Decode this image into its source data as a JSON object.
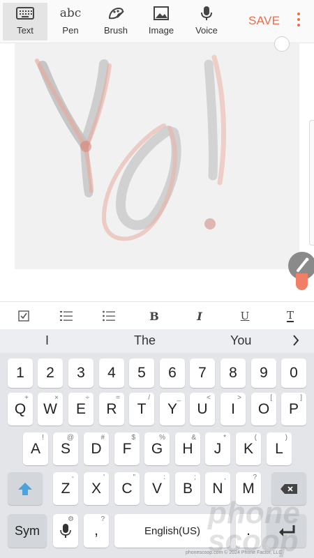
{
  "toolbar": {
    "tools": [
      {
        "label": "Text",
        "icon": "keyboard-icon",
        "active": true
      },
      {
        "label": "Pen",
        "icon": "abc-handwriting-icon",
        "glyph": "abc"
      },
      {
        "label": "Brush",
        "icon": "brush-icon"
      },
      {
        "label": "Image",
        "icon": "image-icon"
      },
      {
        "label": "Voice",
        "icon": "microphone-icon"
      }
    ],
    "save_label": "SAVE",
    "accent": "#f06b45"
  },
  "formatting": {
    "bold": "B",
    "italic": "I",
    "underline": "U",
    "text_color": "T"
  },
  "suggestions": [
    "I",
    "The",
    "You"
  ],
  "keyboard": {
    "row_numbers": [
      "1",
      "2",
      "3",
      "4",
      "5",
      "6",
      "7",
      "8",
      "9",
      "0"
    ],
    "row1": [
      {
        "k": "Q",
        "s": "+"
      },
      {
        "k": "W",
        "s": "×"
      },
      {
        "k": "E",
        "s": "÷"
      },
      {
        "k": "R",
        "s": "="
      },
      {
        "k": "T",
        "s": "/"
      },
      {
        "k": "Y",
        "s": "_"
      },
      {
        "k": "U",
        "s": "<"
      },
      {
        "k": "I",
        "s": ">"
      },
      {
        "k": "O",
        "s": "["
      },
      {
        "k": "P",
        "s": "]"
      }
    ],
    "row2": [
      {
        "k": "A",
        "s": "!"
      },
      {
        "k": "S",
        "s": "@"
      },
      {
        "k": "D",
        "s": "#"
      },
      {
        "k": "F",
        "s": "$"
      },
      {
        "k": "G",
        "s": "%"
      },
      {
        "k": "H",
        "s": "&"
      },
      {
        "k": "J",
        "s": "*"
      },
      {
        "k": "K",
        "s": "("
      },
      {
        "k": "L",
        "s": ")"
      }
    ],
    "row3": [
      {
        "k": "Z",
        "s": "-"
      },
      {
        "k": "X",
        "s": "'"
      },
      {
        "k": "C",
        "s": "\""
      },
      {
        "k": "V",
        "s": ":"
      },
      {
        "k": "B",
        "s": ";"
      },
      {
        "k": "N",
        "s": ","
      },
      {
        "k": "M",
        "s": "?"
      }
    ],
    "sym_label": "Sym",
    "comma": ",",
    "comma_sub": "?",
    "space_label": "English(US)",
    "period": ".",
    "shift_color": "#4aa3df"
  },
  "watermark": {
    "text": "phone scoop",
    "footer": "phonescoop.com  © 2024 Phone Factor, LLC"
  }
}
